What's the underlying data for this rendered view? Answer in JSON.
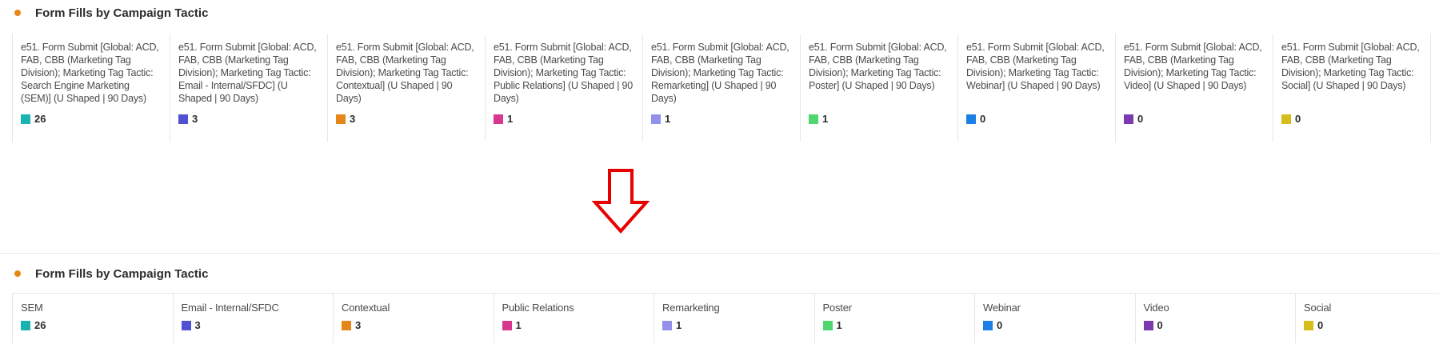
{
  "top_panel": {
    "title": "Form Fills by Campaign Tactic",
    "tiles": [
      {
        "label": "e51. Form Submit [Global: ACD, FAB, CBB (Marketing Tag Division); Marketing Tag Tactic: Search Engine Marketing (SEM)] (U Shaped | 90 Days)",
        "value": "26",
        "color": "#18b4b4"
      },
      {
        "label": "e51. Form Submit [Global: ACD, FAB, CBB (Marketing Tag Division); Marketing Tag Tactic: Email - Internal/SFDC] (U Shaped | 90 Days)",
        "value": "3",
        "color": "#5151d3"
      },
      {
        "label": "e51. Form Submit [Global: ACD, FAB, CBB (Marketing Tag Division); Marketing Tag Tactic: Contextual] (U Shaped | 90 Days)",
        "value": "3",
        "color": "#e68619"
      },
      {
        "label": "e51. Form Submit [Global: ACD, FAB, CBB (Marketing Tag Division); Marketing Tag Tactic: Public Relations] (U Shaped | 90 Days)",
        "value": "1",
        "color": "#d83790"
      },
      {
        "label": "e51. Form Submit [Global: ACD, FAB, CBB (Marketing Tag Division); Marketing Tag Tactic: Remarketing] (U Shaped | 90 Days)",
        "value": "1",
        "color": "#9390ec"
      },
      {
        "label": "e51. Form Submit [Global: ACD, FAB, CBB (Marketing Tag Division); Marketing Tag Tactic: Poster] (U Shaped | 90 Days)",
        "value": "1",
        "color": "#4fd66f"
      },
      {
        "label": "e51. Form Submit [Global: ACD, FAB, CBB (Marketing Tag Division); Marketing Tag Tactic: Webinar] (U Shaped | 90 Days)",
        "value": "0",
        "color": "#1c7fe6"
      },
      {
        "label": "e51. Form Submit [Global: ACD, FAB, CBB (Marketing Tag Division); Marketing Tag Tactic: Video] (U Shaped | 90 Days)",
        "value": "0",
        "color": "#7b3ab0"
      },
      {
        "label": "e51. Form Submit [Global: ACD, FAB, CBB (Marketing Tag Division); Marketing Tag Tactic: Social] (U Shaped | 90 Days)",
        "value": "0",
        "color": "#d6bd1c"
      }
    ]
  },
  "bottom_panel": {
    "title": "Form Fills by Campaign Tactic",
    "tiles": [
      {
        "label": "SEM",
        "value": "26",
        "color": "#18b4b4"
      },
      {
        "label": "Email - Internal/SFDC",
        "value": "3",
        "color": "#5151d3"
      },
      {
        "label": "Contextual",
        "value": "3",
        "color": "#e68619"
      },
      {
        "label": "Public Relations",
        "value": "1",
        "color": "#d83790"
      },
      {
        "label": "Remarketing",
        "value": "1",
        "color": "#9390ec"
      },
      {
        "label": "Poster",
        "value": "1",
        "color": "#4fd66f"
      },
      {
        "label": "Webinar",
        "value": "0",
        "color": "#1c7fe6"
      },
      {
        "label": "Video",
        "value": "0",
        "color": "#7b3ab0"
      },
      {
        "label": "Social",
        "value": "0",
        "color": "#d6bd1c"
      }
    ]
  },
  "colors": {
    "accent_dot": "#e68619",
    "arrow": "#e60000"
  }
}
